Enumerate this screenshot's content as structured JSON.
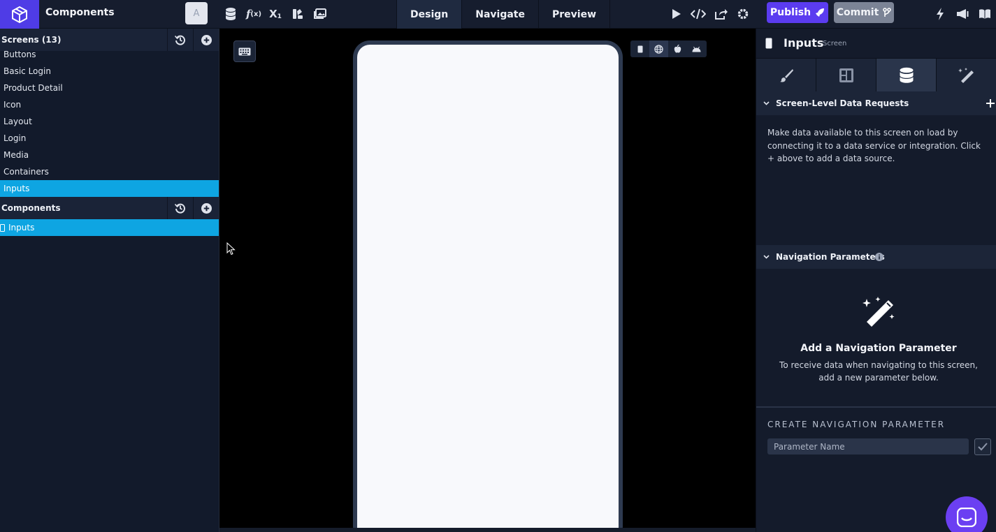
{
  "app": {
    "title": "Components",
    "avatar_letter": "A",
    "brand_color": "#4f3ce6"
  },
  "toolbar": {
    "icons": [
      "database-icon",
      "function-icon",
      "subscript-icon",
      "palette-icon",
      "media-library-icon"
    ],
    "modes": [
      {
        "label": "Design",
        "active": true
      },
      {
        "label": "Navigate",
        "active": false
      },
      {
        "label": "Preview",
        "active": false
      }
    ],
    "right_icons": [
      "play-icon",
      "code-icon",
      "share-icon",
      "gear-icon"
    ],
    "publish_label": "Publish",
    "commit_label": "Commit",
    "far_right_icons": [
      "lightning-icon",
      "megaphone-icon",
      "book-icon"
    ]
  },
  "sidebar": {
    "screens_title": "Screens (13)",
    "screens": [
      "Buttons",
      "Basic Login",
      "Product Detail",
      "Icon",
      "Layout",
      "Login",
      "Media",
      "Containers",
      "Inputs"
    ],
    "selected_screen": "Inputs",
    "components_title": "Components",
    "components": [
      "Inputs"
    ]
  },
  "canvas": {
    "platforms": [
      "mobile-icon",
      "web-icon",
      "apple-icon",
      "android-icon"
    ],
    "active_platform": "web-icon"
  },
  "panel": {
    "title": "Inputs",
    "subtitle": "Screen",
    "tabs": [
      "brush-icon",
      "layout-icon",
      "database-icon",
      "magic-wand-icon"
    ],
    "active_tab": 2,
    "data_requests_title": "Screen-Level Data Requests",
    "data_requests_desc": "Make data available to this screen on load by connecting it to a data service or integration. Click + above to add a data source.",
    "nav_params_title": "Navigation Parameters",
    "add_param_title": "Add a Navigation Parameter",
    "add_param_desc": "To receive data when navigating to this screen, add a new parameter below.",
    "create_label": "CREATE NAVIGATION PARAMETER",
    "param_placeholder": "Parameter Name"
  },
  "colors": {
    "selection": "#0ea5e2",
    "publish": "#5b3cf0",
    "commit": "#7c8496"
  }
}
